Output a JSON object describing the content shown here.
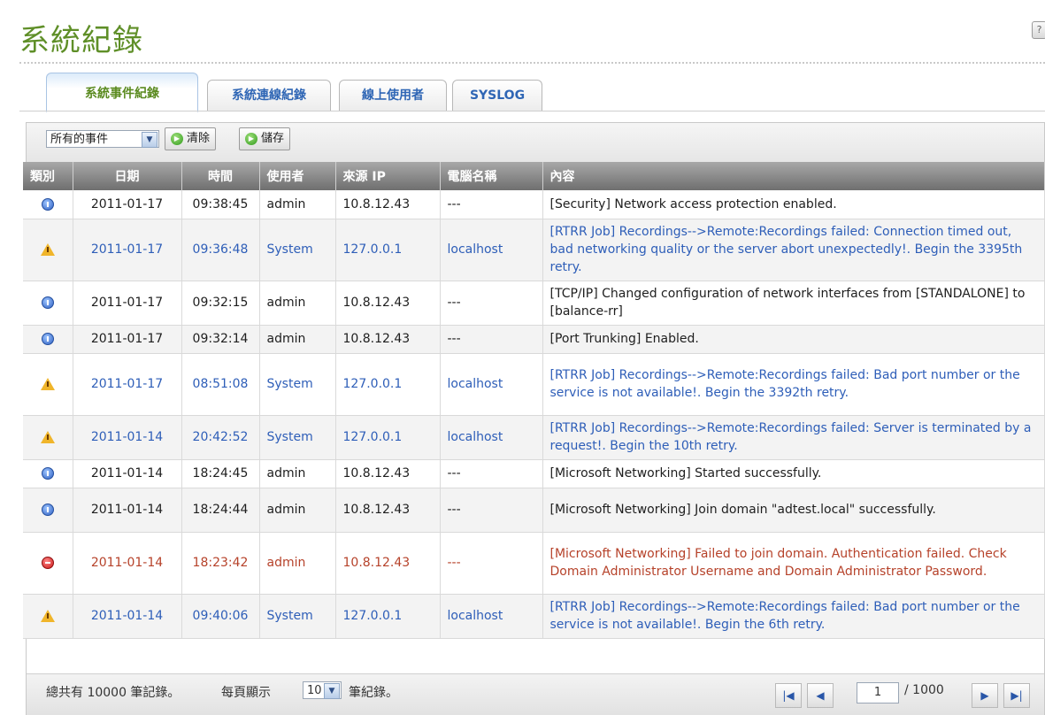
{
  "page": {
    "title": "系統紀錄"
  },
  "tabs": [
    {
      "label": "系統事件紀錄"
    },
    {
      "label": "系統連線紀錄"
    },
    {
      "label": "線上使用者"
    },
    {
      "label": "SYSLOG"
    }
  ],
  "toolbar": {
    "filter_value": "所有的事件",
    "clear_label": "清除",
    "save_label": "儲存"
  },
  "table": {
    "headers": [
      "類別",
      "日期",
      "時間",
      "使用者",
      "來源 IP",
      "電腦名稱",
      "內容"
    ],
    "rows": [
      {
        "level": "info",
        "date": "2011-01-17",
        "time": "09:38:45",
        "user": "admin",
        "ip": "10.8.12.43",
        "host": "---",
        "content": "[Security] Network access protection enabled."
      },
      {
        "level": "warn",
        "date": "2011-01-17",
        "time": "09:36:48",
        "user": "System",
        "ip": "127.0.0.1",
        "host": "localhost",
        "content": "[RTRR Job] Recordings-->Remote:Recordings failed: Connection timed out, bad networking quality or the server abort unexpectedly!. Begin the 3395th retry."
      },
      {
        "level": "info",
        "date": "2011-01-17",
        "time": "09:32:15",
        "user": "admin",
        "ip": "10.8.12.43",
        "host": "---",
        "content": "[TCP/IP] Changed configuration of network interfaces from [STANDALONE] to [balance-rr]"
      },
      {
        "level": "info",
        "date": "2011-01-17",
        "time": "09:32:14",
        "user": "admin",
        "ip": "10.8.12.43",
        "host": "---",
        "content": "[Port Trunking] Enabled."
      },
      {
        "level": "warn",
        "date": "2011-01-17",
        "time": "08:51:08",
        "user": "System",
        "ip": "127.0.0.1",
        "host": "localhost",
        "content": "[RTRR Job] Recordings-->Remote:Recordings failed: Bad port number or the service is not available!. Begin the 3392th retry."
      },
      {
        "level": "warn",
        "date": "2011-01-14",
        "time": "20:42:52",
        "user": "System",
        "ip": "127.0.0.1",
        "host": "localhost",
        "content": "[RTRR Job] Recordings-->Remote:Recordings failed: Server is terminated by a request!. Begin the 10th retry."
      },
      {
        "level": "info",
        "date": "2011-01-14",
        "time": "18:24:45",
        "user": "admin",
        "ip": "10.8.12.43",
        "host": "---",
        "content": "[Microsoft Networking] Started successfully."
      },
      {
        "level": "info",
        "date": "2011-01-14",
        "time": "18:24:44",
        "user": "admin",
        "ip": "10.8.12.43",
        "host": "---",
        "content": "[Microsoft Networking] Join domain \"adtest.local\" successfully."
      },
      {
        "level": "error",
        "date": "2011-01-14",
        "time": "18:23:42",
        "user": "admin",
        "ip": "10.8.12.43",
        "host": "---",
        "content": "[Microsoft Networking] Failed to join domain. Authentication failed. Check Domain Administrator Username and Domain Administrator Password."
      },
      {
        "level": "warn",
        "date": "2011-01-14",
        "time": "09:40:06",
        "user": "System",
        "ip": "127.0.0.1",
        "host": "localhost",
        "content": "[RTRR Job] Recordings-->Remote:Recordings failed: Bad port number or the service is not available!. Begin the 6th retry."
      }
    ]
  },
  "footer": {
    "total_text": "總共有 10000 筆記錄。",
    "per_page_prefix": "每頁顯示",
    "per_page_value": "10",
    "per_page_suffix": "筆紀錄。",
    "page_current": "1",
    "page_total": "/ 1000"
  },
  "icons": {
    "info": "info-icon",
    "warn": "warning-icon",
    "error": "error-icon",
    "help": "help-icon",
    "first": "first-page-icon",
    "prev": "prev-page-icon",
    "next": "next-page-icon",
    "last": "last-page-icon"
  },
  "colors": {
    "title": "#5f8f28",
    "info_text": "#1e1e1e",
    "warn_text": "#2e5eb8",
    "error_text": "#b6422a",
    "header_bg": "#8a8a8a"
  }
}
